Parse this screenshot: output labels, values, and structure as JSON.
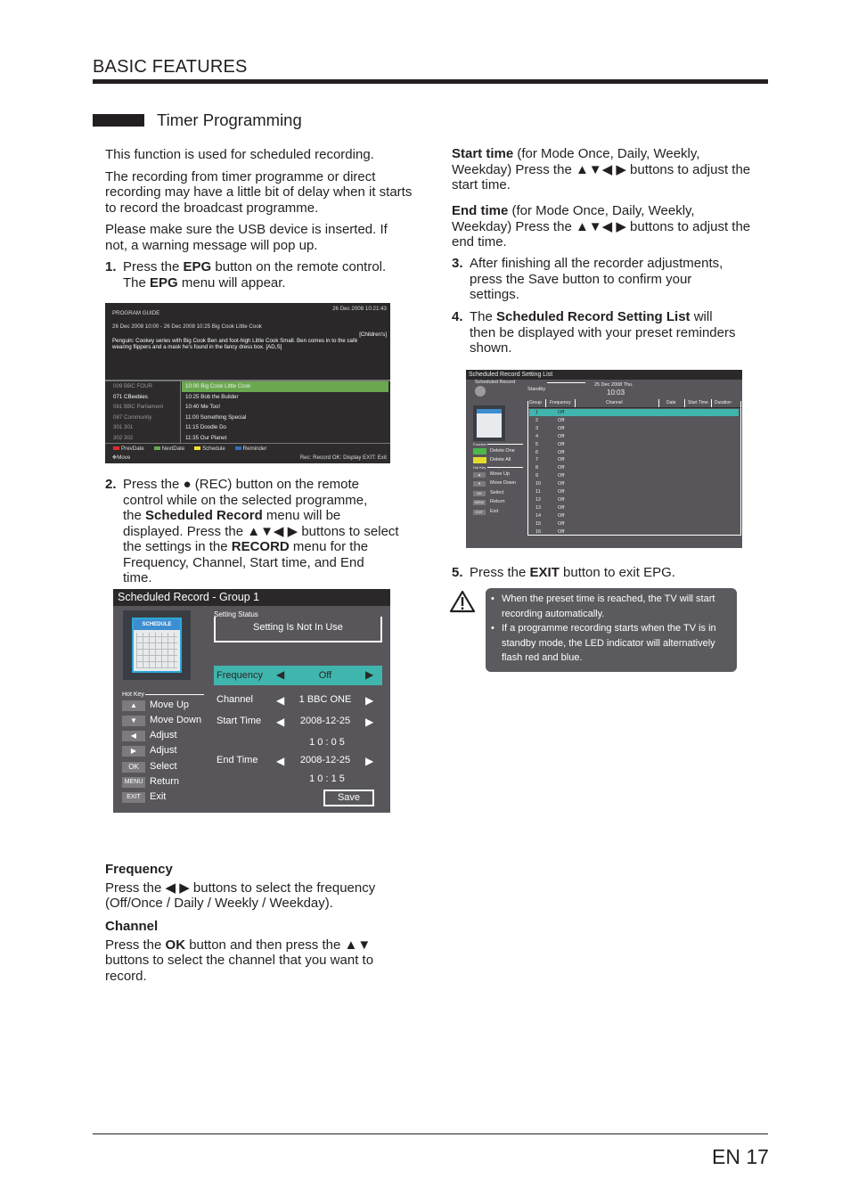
{
  "header": {
    "section": "BASIC FEATURES"
  },
  "section_title": "Timer Programming",
  "intro": [
    "This function is used for scheduled recording.",
    "The recording from timer programme or direct recording may have a little bit of delay when it starts to record the broadcast programme.",
    "Please make sure the USB device is inserted. If not, a warning message will pop up."
  ],
  "steps": {
    "s1": {
      "num": "1.",
      "line1_pre": "Press the ",
      "line1_bold": "EPG",
      "line1_post": " button on the remote control.",
      "line2_pre": "The ",
      "line2_bold": "EPG",
      "line2_post": " menu will appear."
    },
    "s2": {
      "num": "2.",
      "l1": "Press the ● (REC) button on the remote",
      "l2": "control while on the selected programme,",
      "l3_pre": "the ",
      "l3_bold": "Scheduled Record",
      "l3_post": " menu will be",
      "l4": "displayed. Press the ▲▼◀ ▶ buttons to select",
      "l5_pre": "the settings in the ",
      "l5_bold": "RECORD",
      "l5_post": " menu for the",
      "l6": "Frequency, Channel, Start time, and End",
      "l7": "time."
    },
    "s3": {
      "num": "3.",
      "l1": "After finishing all the recorder adjustments,",
      "l2": "press the Save button to confirm your",
      "l3": "settings."
    },
    "s4": {
      "num": "4.",
      "l1_pre": "The ",
      "l1_bold": "Scheduled Record Setting List",
      "l1_post": " will",
      "l2": "then be displayed with your preset reminders",
      "l3": "shown."
    },
    "s5": {
      "num": "5.",
      "pre": "Press the ",
      "bold": "EXIT",
      "post": " button to exit EPG."
    }
  },
  "start_time": {
    "bold": "Start time",
    "l1": " (for Mode Once, Daily, Weekly,",
    "l2": "Weekday) Press the ▲▼◀ ▶ buttons to adjust the",
    "l3": "start time."
  },
  "end_time": {
    "bold": "End time",
    "l1": " (for Mode Once, Daily, Weekly,",
    "l2": "Weekday) Press the ▲▼◀ ▶ buttons to adjust the",
    "l3": "end time."
  },
  "frequency": {
    "title": "Frequency",
    "l1": "Press the ◀ ▶ buttons to select the frequency",
    "l2": "(Off/Once / Daily / Weekly / Weekday)."
  },
  "channel": {
    "title": "Channel",
    "l1_pre": "Press the ",
    "l1_bold": "OK",
    "l1_post": " button and then press the ▲▼",
    "l2": "buttons to select the channel that you want to",
    "l3": "record."
  },
  "epg": {
    "title": "PROGRAM GUIDE",
    "datetime": "26 Dec 2008 10:21:43",
    "event": "26 Dec 2008 10:00 - 26 Dec 2008 10:25 Big Cook Little Cook",
    "genre": "[Children's]",
    "desc1": "Penguin: Cookey series with Big Cook Ben and foot-high Little Cook Small. Ben comes in to the café",
    "desc2": "wearing flippers and a mask he's found in the fancy dress box. [AD,S]",
    "channels": [
      "009 BBC FOUR",
      "071 CBeebies",
      "081 BBC Parliament",
      "087 Community",
      "301 301",
      "302 302"
    ],
    "programmes": [
      "10:00 Big Cook Little Cook",
      "10:25 Bob the Builder",
      "10:40 Me Too!",
      "11:00 Something Special",
      "11:15 Doodle Do",
      "11:35 Our Planet"
    ],
    "legend": [
      {
        "label": "PrevDate",
        "color": "#e02a2a"
      },
      {
        "label": "NextDate",
        "color": "#6aa84f"
      },
      {
        "label": "Schedule",
        "color": "#f2e22b"
      },
      {
        "label": "Reminder",
        "color": "#2b6fc0"
      }
    ],
    "move": "Move",
    "keys": "Rec: Record  OK: Display  EXIT: Exit"
  },
  "sched": {
    "title": "Scheduled Record - Group 1",
    "icon_text": "SCHEDULE",
    "status_label": "Setting Status",
    "status": "Setting Is Not In Use",
    "frequency_label": "Frequency",
    "frequency_value": "Off",
    "channel_label": "Channel",
    "channel_value": "1 BBC ONE",
    "start_label": "Start Time",
    "start_date": "2008-12-25",
    "start_time": "1 0 : 0 5",
    "end_label": "End Time",
    "end_date": "2008-12-25",
    "end_time": "1 0 : 1 5",
    "save": "Save",
    "hotkey_label": "Hot Key",
    "hotkeys": [
      {
        "key": "▲",
        "label": "Move Up"
      },
      {
        "key": "▼",
        "label": "Move Down"
      },
      {
        "key": "◀",
        "label": "Adjust"
      },
      {
        "key": "▶",
        "label": "Adjust"
      },
      {
        "key": "OK",
        "label": "Select"
      },
      {
        "key": "MENU",
        "label": "Return"
      },
      {
        "key": "EXIT",
        "label": "Exit"
      }
    ],
    "accent": "#3fb5ad"
  },
  "setlist": {
    "title": "Scheduled Record Setting List",
    "sub": "Scheduled Record",
    "status": "Standby",
    "date": "25 Dec 2008 Thu.",
    "time": "10:03",
    "function_label": "Function",
    "delete_one": "Delete One",
    "delete_all": "Delete All",
    "hotkey_label": "Hot Key",
    "hotkeys": [
      {
        "key": "▲",
        "label": "Move Up"
      },
      {
        "key": "▼",
        "label": "Move Down"
      },
      {
        "key": "OK",
        "label": "Select"
      },
      {
        "key": "MENU",
        "label": "Return"
      },
      {
        "key": "EXIT",
        "label": "Exit"
      }
    ],
    "columns": [
      "Group",
      "Frequency",
      "Channel",
      "Date",
      "Start Time",
      "Duration"
    ],
    "rows": [
      {
        "group": "1",
        "freq": "Off"
      },
      {
        "group": "2",
        "freq": "Off"
      },
      {
        "group": "3",
        "freq": "Off"
      },
      {
        "group": "4",
        "freq": "Off"
      },
      {
        "group": "5",
        "freq": "Off"
      },
      {
        "group": "6",
        "freq": "Off"
      },
      {
        "group": "7",
        "freq": "Off"
      },
      {
        "group": "8",
        "freq": "Off"
      },
      {
        "group": "9",
        "freq": "Off"
      },
      {
        "group": "10",
        "freq": "Off"
      },
      {
        "group": "11",
        "freq": "Off"
      },
      {
        "group": "12",
        "freq": "Off"
      },
      {
        "group": "13",
        "freq": "Off"
      },
      {
        "group": "14",
        "freq": "Off"
      },
      {
        "group": "15",
        "freq": "Off"
      },
      {
        "group": "16",
        "freq": "Off"
      }
    ]
  },
  "note": {
    "icon": "warning-icon",
    "b1": "When the preset time is reached, the TV will start recording automatically.",
    "b2": "If a programme recording starts when the TV is in standby mode, the LED indicator will alternatively flash red and blue."
  },
  "page_number": "EN 17"
}
